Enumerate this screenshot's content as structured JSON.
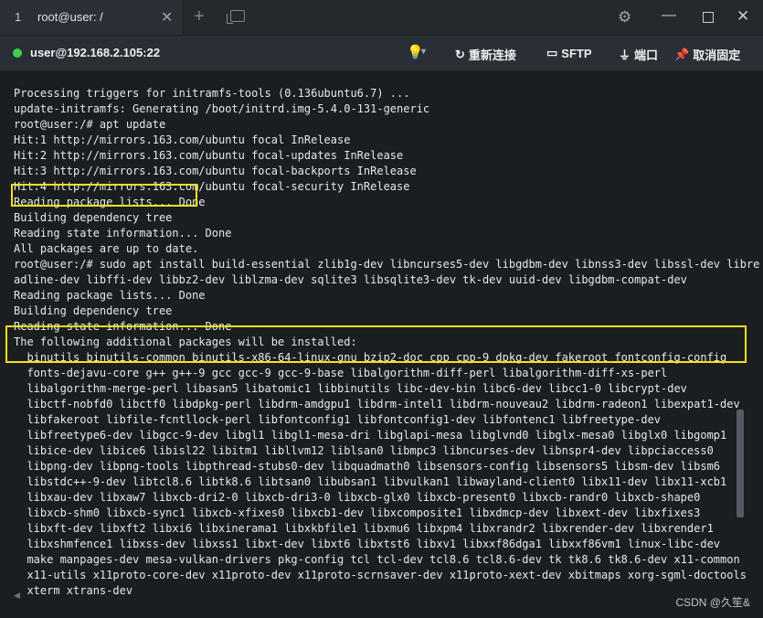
{
  "tab": {
    "number": "1",
    "title": "root@user: /",
    "close": "✕"
  },
  "window": {
    "new_tab": "+",
    "settings_icon": "gear-icon",
    "minimize": "—",
    "close": "✕"
  },
  "toolbar": {
    "connection": "user@192.168.2.105:22",
    "status_color": "#3ecf4a",
    "bulb_caret": "▾",
    "reconnect": "重新连接",
    "sftp": "SFTP",
    "port": "端口",
    "unpin": "取消固定"
  },
  "terminal": {
    "lines": [
      "Processing triggers for initramfs-tools (0.136ubuntu6.7) ...",
      "update-initramfs: Generating /boot/initrd.img-5.4.0-131-generic",
      "root@user:/# apt update",
      "Hit:1 http://mirrors.163.com/ubuntu focal InRelease",
      "Hit:2 http://mirrors.163.com/ubuntu focal-updates InRelease",
      "Hit:3 http://mirrors.163.com/ubuntu focal-backports InRelease",
      "Hit:4 http://mirrors.163.com/ubuntu focal-security InRelease",
      "Reading package lists... Done",
      "Building dependency tree",
      "Reading state information... Done",
      "All packages are up to date.",
      "root@user:/# sudo apt install build-essential zlib1g-dev libncurses5-dev libgdbm-dev libnss3-dev libssl-dev libre",
      "adline-dev libffi-dev libbz2-dev liblzma-dev sqlite3 libsqlite3-dev tk-dev uuid-dev libgdbm-compat-dev",
      "Reading package lists... Done",
      "Building dependency tree",
      "Reading state information... Done",
      "The following additional packages will be installed:",
      "  binutils binutils-common binutils-x86-64-linux-gnu bzip2-doc cpp cpp-9 dpkg-dev fakeroot fontconfig-config",
      "  fonts-dejavu-core g++ g++-9 gcc gcc-9 gcc-9-base libalgorithm-diff-perl libalgorithm-diff-xs-perl",
      "  libalgorithm-merge-perl libasan5 libatomic1 libbinutils libc-dev-bin libc6-dev libcc1-0 libcrypt-dev",
      "  libctf-nobfd0 libctf0 libdpkg-perl libdrm-amdgpu1 libdrm-intel1 libdrm-nouveau2 libdrm-radeon1 libexpat1-dev",
      "  libfakeroot libfile-fcntllock-perl libfontconfig1 libfontconfig1-dev libfontenc1 libfreetype-dev",
      "  libfreetype6-dev libgcc-9-dev libgl1 libgl1-mesa-dri libglapi-mesa libglvnd0 libglx-mesa0 libglx0 libgomp1",
      "  libice-dev libice6 libisl22 libitm1 libllvm12 liblsan0 libmpc3 libncurses-dev libnspr4-dev libpciaccess0",
      "  libpng-dev libpng-tools libpthread-stubs0-dev libquadmath0 libsensors-config libsensors5 libsm-dev libsm6",
      "  libstdc++-9-dev libtcl8.6 libtk8.6 libtsan0 libubsan1 libvulkan1 libwayland-client0 libx11-dev libx11-xcb1",
      "  libxau-dev libxaw7 libxcb-dri2-0 libxcb-dri3-0 libxcb-glx0 libxcb-present0 libxcb-randr0 libxcb-shape0",
      "  libxcb-shm0 libxcb-sync1 libxcb-xfixes0 libxcb1-dev libxcomposite1 libxdmcp-dev libxext-dev libxfixes3",
      "  libxft-dev libxft2 libxi6 libxinerama1 libxkbfile1 libxmu6 libxpm4 libxrandr2 libxrender-dev libxrender1",
      "  libxshmfence1 libxss-dev libxss1 libxt-dev libxt6 libxtst6 libxv1 libxxf86dga1 libxxf86vm1 linux-libc-dev",
      "  make manpages-dev mesa-vulkan-drivers pkg-config tcl tcl-dev tcl8.6 tcl8.6-dev tk tk8.6 tk8.6-dev x11-common",
      "  x11-utils x11proto-core-dev x11proto-dev x11proto-scrnsaver-dev x11proto-xext-dev xbitmaps xorg-sgml-doctools",
      "  xterm xtrans-dev"
    ],
    "watermark": "CSDN @久笙&",
    "highlight_color": "#f2e21c"
  }
}
